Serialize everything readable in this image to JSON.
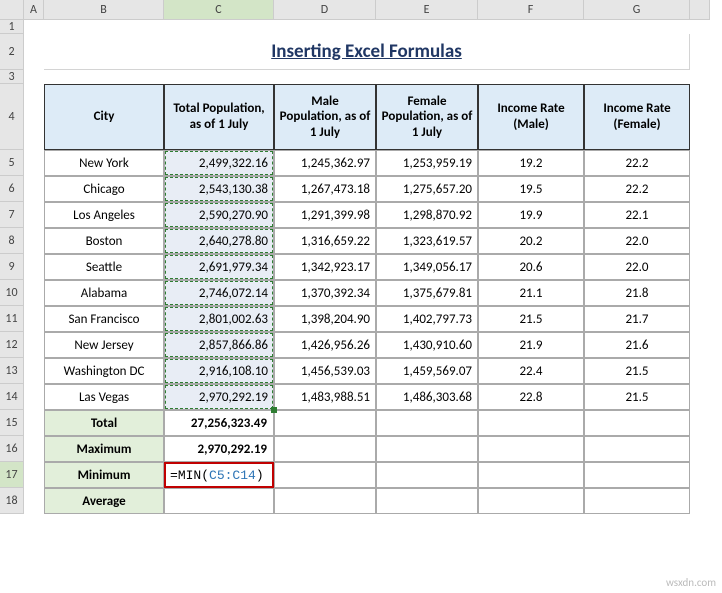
{
  "columns": [
    "",
    "A",
    "B",
    "C",
    "D",
    "E",
    "F",
    "G",
    ""
  ],
  "active_column": "C",
  "active_row": "17",
  "rows": [
    "1",
    "2",
    "3",
    "4",
    "5",
    "6",
    "7",
    "8",
    "9",
    "10",
    "11",
    "12",
    "13",
    "14",
    "15",
    "16",
    "17",
    "18"
  ],
  "title": "Inserting Excel Formulas",
  "headers": {
    "city": "City",
    "total_pop": "Total Population, as of 1 July",
    "male_pop": "Male Population, as of 1 July",
    "female_pop": "Female Population, as of 1 July",
    "income_male": "Income Rate (Male)",
    "income_female": "Income Rate (Female)"
  },
  "data": [
    {
      "city": "New York",
      "total": "2,499,322.16",
      "male": "1,245,362.97",
      "female": "1,253,959.19",
      "im": "19.2",
      "if": "22.2"
    },
    {
      "city": "Chicago",
      "total": "2,543,130.38",
      "male": "1,267,473.18",
      "female": "1,275,657.20",
      "im": "19.5",
      "if": "22.2"
    },
    {
      "city": "Los Angeles",
      "total": "2,590,270.90",
      "male": "1,291,399.98",
      "female": "1,298,870.92",
      "im": "19.9",
      "if": "22.1"
    },
    {
      "city": "Boston",
      "total": "2,640,278.80",
      "male": "1,316,659.22",
      "female": "1,323,619.57",
      "im": "20.2",
      "if": "22.0"
    },
    {
      "city": "Seattle",
      "total": "2,691,979.34",
      "male": "1,342,923.17",
      "female": "1,349,056.17",
      "im": "20.6",
      "if": "22.0"
    },
    {
      "city": "Alabama",
      "total": "2,746,072.14",
      "male": "1,370,392.34",
      "female": "1,375,679.81",
      "im": "21.1",
      "if": "21.8"
    },
    {
      "city": "San Francisco",
      "total": "2,801,002.63",
      "male": "1,398,204.90",
      "female": "1,402,797.73",
      "im": "21.5",
      "if": "21.7"
    },
    {
      "city": "New Jersey",
      "total": "2,857,866.86",
      "male": "1,426,956.26",
      "female": "1,430,910.60",
      "im": "21.9",
      "if": "21.6"
    },
    {
      "city": "Washington DC",
      "total": "2,916,108.10",
      "male": "1,456,539.03",
      "female": "1,459,569.07",
      "im": "22.4",
      "if": "21.5"
    },
    {
      "city": "Las Vegas",
      "total": "2,970,292.19",
      "male": "1,483,988.51",
      "female": "1,486,303.68",
      "im": "22.8",
      "if": "21.5"
    }
  ],
  "summary": {
    "total_label": "Total",
    "total_value": "27,256,323.49",
    "max_label": "Maximum",
    "max_value": "2,970,292.19",
    "min_label": "Minimum",
    "min_formula_prefix": "=MIN(",
    "min_formula_ref": "C5:C14",
    "min_formula_suffix": ")",
    "avg_label": "Average"
  },
  "watermark": "wsxdn.com"
}
